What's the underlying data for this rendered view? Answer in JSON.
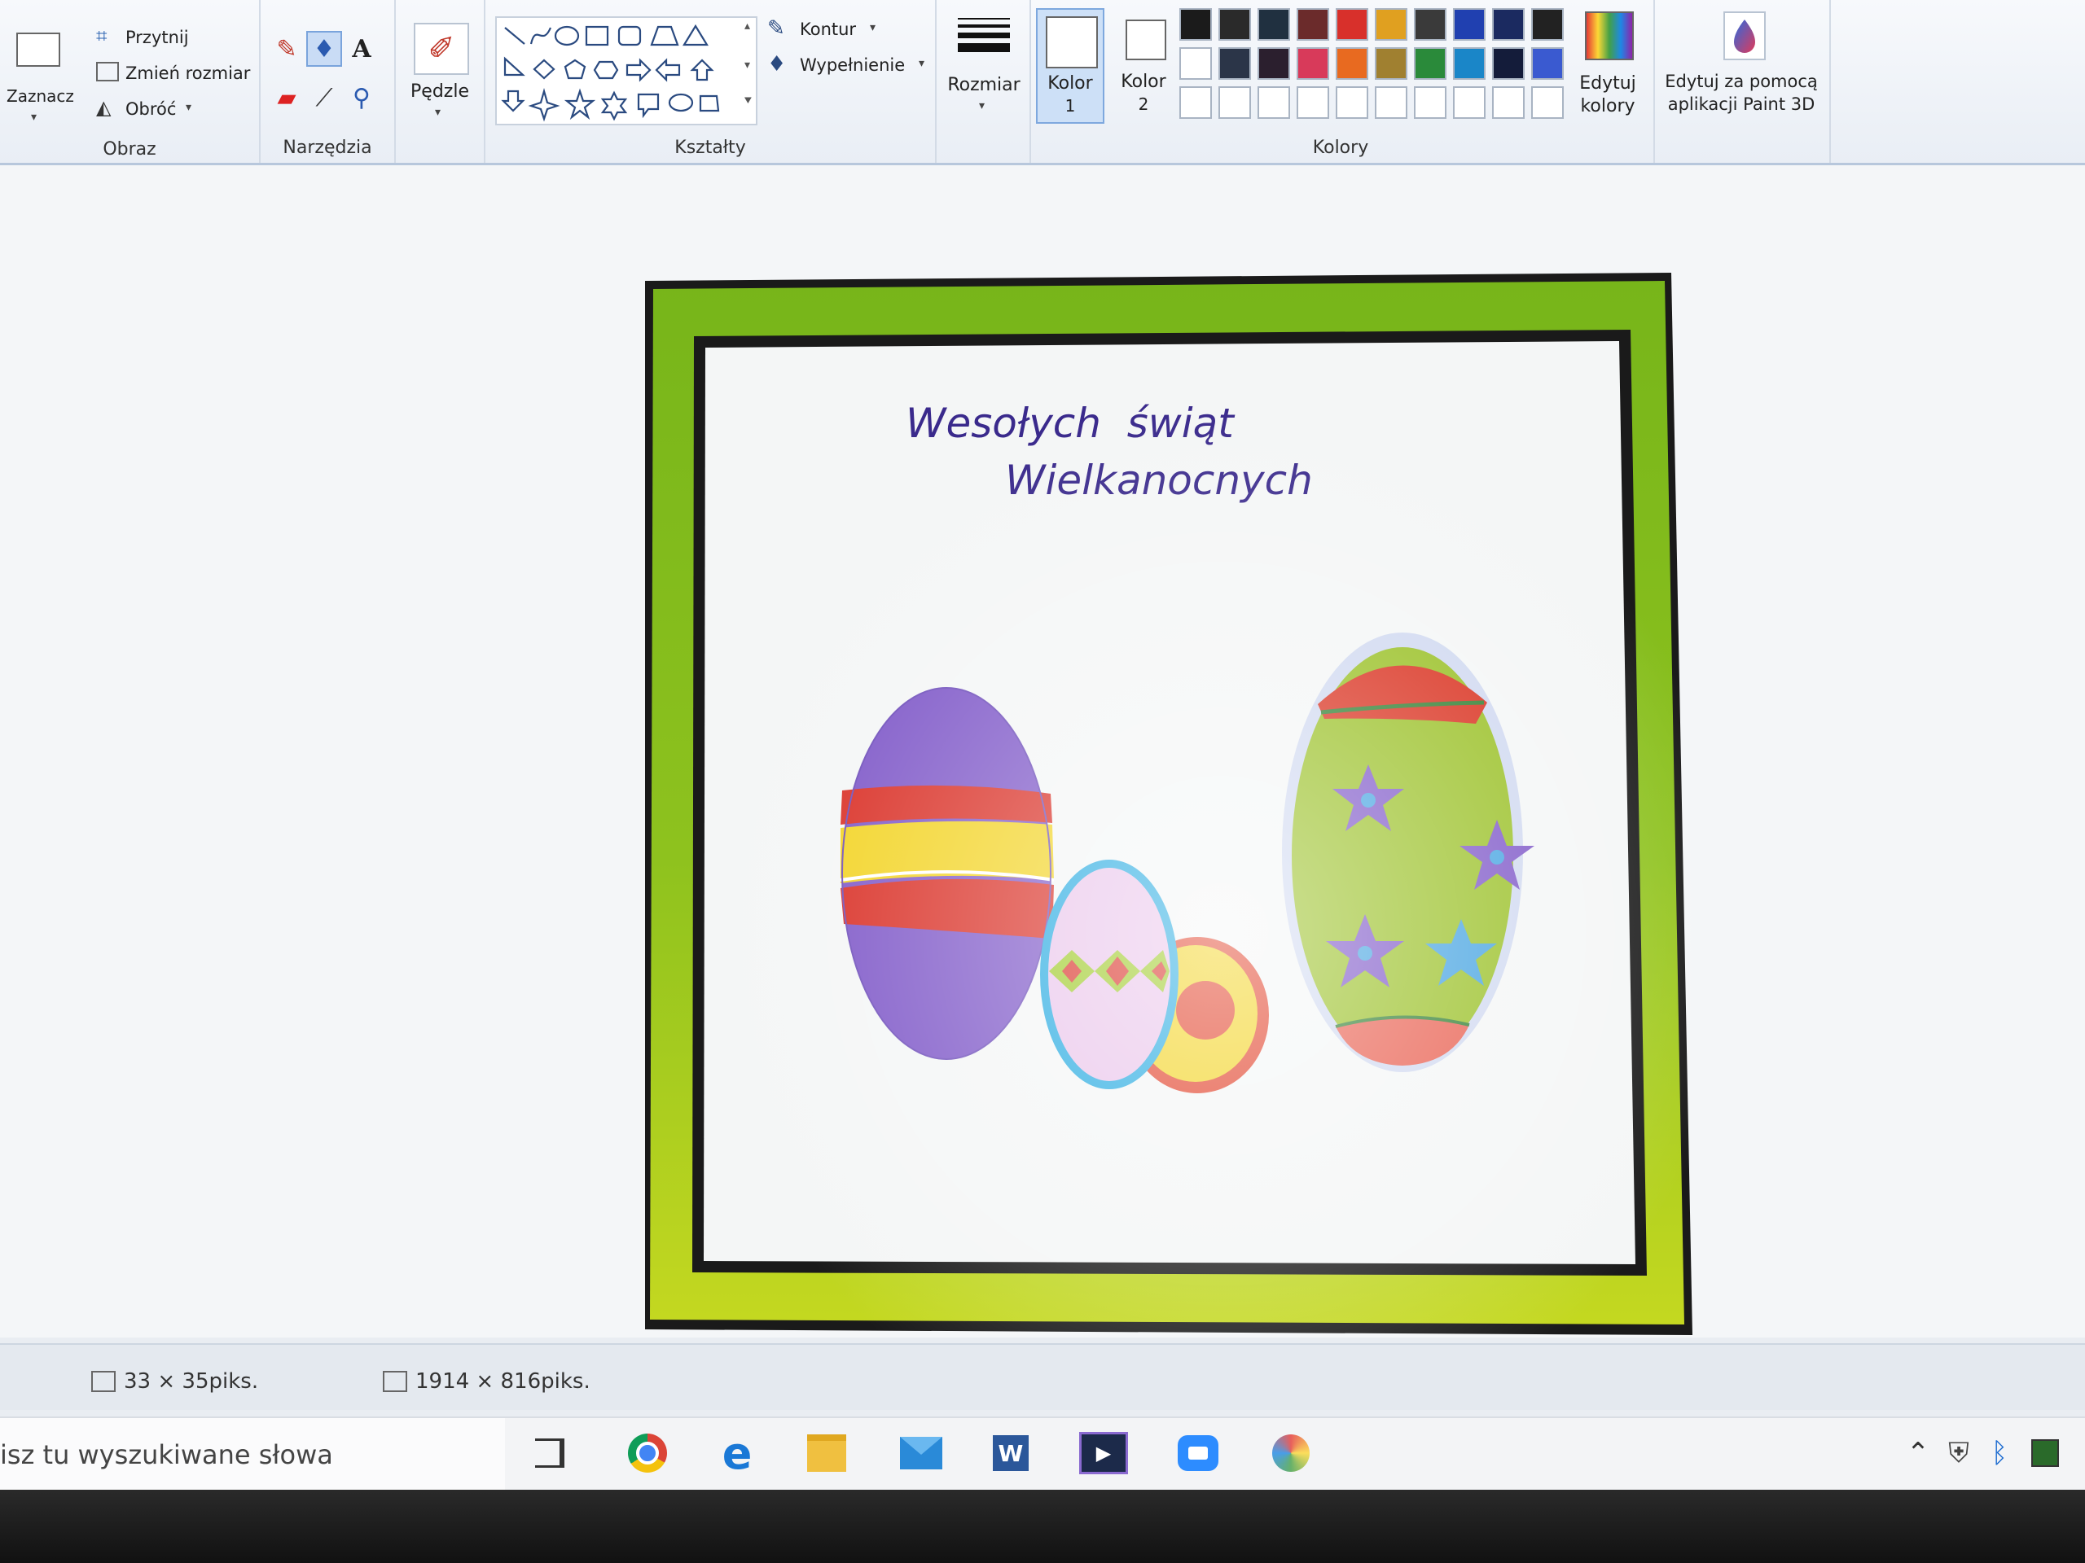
{
  "ribbon": {
    "obraz": {
      "select_label": "Zaznacz",
      "crop_label": "Przytnij",
      "resize_label": "Zmień rozmiar",
      "rotate_label": "Obróć",
      "group_label": "Obraz"
    },
    "narzedzia": {
      "group_label": "Narzędzia"
    },
    "brushes_label": "Pędzle",
    "ksztalty": {
      "outline_label": "Kontur",
      "fill_label": "Wypełnienie",
      "group_label": "Kształty"
    },
    "size_label": "Rozmiar",
    "color1_label": "Kolor",
    "color1_num": "1",
    "color2_label": "Kolor",
    "color2_num": "2",
    "colors_group_label": "Kolory",
    "edit_colors_label_1": "Edytuj",
    "edit_colors_label_2": "kolory",
    "paint3d_label_1": "Edytuj za pomocą",
    "paint3d_label_2": "aplikacji Paint 3D",
    "palette_row1": [
      "#1b1b1b",
      "#2a2a2a",
      "#203040",
      "#6b2b2b",
      "#d8302b",
      "#e0a020",
      "#3a3a3a",
      "#2040b0",
      "#1b2a60",
      "#222222"
    ],
    "palette_row2": [
      "#ffffff",
      "#2b3548",
      "#2b1f2e",
      "#d83a5a",
      "#e86a20",
      "#a08030",
      "#2a8a3a",
      "#1a86c8",
      "#141c3a",
      "#3a5ad0"
    ]
  },
  "card": {
    "line1": "Wesołych  świąt",
    "line2": "Wielkanocnych",
    "colors": {
      "frame_green": "#8fc01c",
      "text": "#3a2a8c"
    }
  },
  "status": {
    "selection_size": "33 × 35piks.",
    "image_size": "1914 × 816piks."
  },
  "taskbar": {
    "search_placeholder": "isz tu wyszukiwane słowa"
  }
}
